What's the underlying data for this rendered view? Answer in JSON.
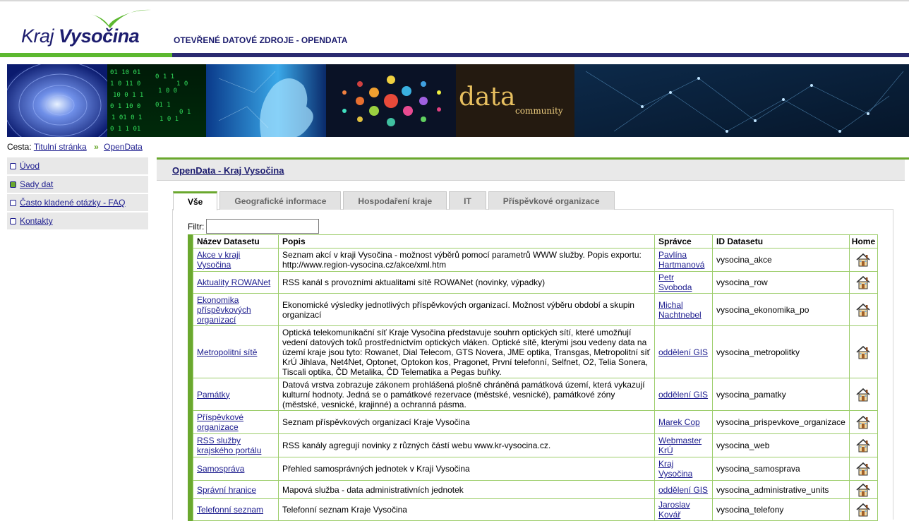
{
  "header": {
    "logo_word1": "Kraj",
    "logo_word2": "Vysočina",
    "site_title": "OTEVŘENÉ DATOVÉ ZDROJE - OPENDATA"
  },
  "banner": {
    "data_word": "data",
    "community_word": "community"
  },
  "breadcrumb": {
    "prefix": "Cesta:",
    "items": [
      "Titulní stránka",
      "OpenData"
    ],
    "separator": "»"
  },
  "sidebar": {
    "items": [
      {
        "label": "Úvod",
        "active": false
      },
      {
        "label": "Sady dat",
        "active": true
      },
      {
        "label": "Často kladené otázky - FAQ",
        "active": false
      },
      {
        "label": "Kontakty",
        "active": false
      }
    ]
  },
  "main": {
    "title": "OpenData - Kraj Vysočina",
    "tabs": [
      "Vše",
      "Geografické informace",
      "Hospodaření kraje",
      "IT",
      "Příspěvkové organizace"
    ],
    "active_tab": "Vše",
    "filter_label": "Filtr:",
    "filter_value": ""
  },
  "table": {
    "headers": [
      "Název Datasetu",
      "Popis",
      "Správce",
      "ID Datasetu",
      "Home"
    ],
    "rows": [
      {
        "name": "Akce v kraji Vysočina",
        "desc": "Seznam akcí v kraji Vysočina - možnost výběrů pomocí parametrů WWW služby. Popis exportu: http://www.region-vysocina.cz/akce/xml.htm",
        "spravce": "Pavlína Hartmanová",
        "id": "vysocina_akce"
      },
      {
        "name": "Aktuality ROWANet",
        "desc": "RSS kanál s provozními aktualitami sítě ROWANet (novinky, výpadky)",
        "spravce": "Petr Svoboda",
        "id": "vysocina_row"
      },
      {
        "name": "Ekonomika příspěvkových organizací",
        "desc": "Ekonomické výsledky jednotlivých příspěvkových organizací. Možnost výběru období a skupin organizací",
        "spravce": "Michal Nachtnebel",
        "id": "vysocina_ekonomika_po"
      },
      {
        "name": "Metropolitní sítě",
        "desc": "Optická telekomunikační síť Kraje Vysočina představuje souhrn optických sítí, které umožňují vedení datových toků prostřednictvím optických vláken. Optické sítě, kterými jsou vedeny data na území kraje jsou tyto: Rowanet, Dial Telecom, GTS Novera, JME optika, Transgas, Metropolitní síť KrÚ Jihlava, Net4Net, Optonet, Optokon kos, Pragonet, První telefonní, Selfnet, O2, Telia Sonera, Tiscali optika, ČD Metalika, ČD Telematika a Pegas buňky.",
        "spravce": "oddělení GIS",
        "id": "vysocina_metropolitky"
      },
      {
        "name": "Památky",
        "desc": "Datová vrstva zobrazuje zákonem prohlášená plošně chráněná památková území, která vykazují kulturní hodnoty. Jedná se o památkové rezervace (městské, vesnické), památkové zóny (městské, vesnické, krajinné) a ochranná pásma.",
        "spravce": "oddělení GIS",
        "id": "vysocina_pamatky"
      },
      {
        "name": "Příspěvkové organizace",
        "desc": "Seznam příspěvkových organizací Kraje Vysočina",
        "spravce": "Marek Cop",
        "id": "vysocina_prispevkove_organizace"
      },
      {
        "name": "RSS služby krajského portálu",
        "desc": "RSS kanály agregují novinky z různých částí webu www.kr-vysocina.cz.",
        "spravce": "Webmaster KrÚ",
        "id": "vysocina_web"
      },
      {
        "name": "Samospráva",
        "desc": "Přehled samosprávných jednotek v Kraji Vysočina",
        "spravce": "Kraj Vysočina",
        "id": "vysocina_samosprava"
      },
      {
        "name": "Správní hranice",
        "desc": "Mapová služba - data administrativních jednotek",
        "spravce": "oddělení GIS",
        "id": "vysocina_administrative_units"
      },
      {
        "name": "Telefonní seznam",
        "desc": "Telefonní seznam Kraje Vysočina",
        "spravce": "Jaroslav Kovář",
        "id": "vysocina_telefony"
      }
    ]
  },
  "colors": {
    "green": "#6aa82e",
    "navy": "#1c1c6e",
    "link": "#1c1c8e"
  }
}
